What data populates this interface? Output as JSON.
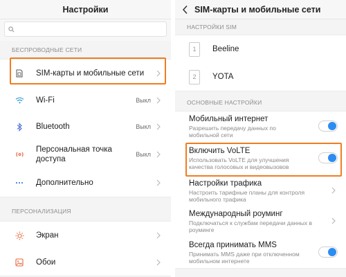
{
  "left": {
    "title": "Настройки",
    "search": {
      "placeholder": ""
    },
    "section_wireless": "БЕСПРОВОДНЫЕ СЕТИ",
    "wireless_items": [
      {
        "label": "SIM-карты и мобильные сети",
        "value": "",
        "icon": "sim-icon"
      },
      {
        "label": "Wi-Fi",
        "value": "Выкл",
        "icon": "wifi-icon"
      },
      {
        "label": "Bluetooth",
        "value": "Выкл",
        "icon": "bluetooth-icon"
      },
      {
        "label": "Персональная точка доступа",
        "value": "Выкл",
        "icon": "hotspot-icon"
      },
      {
        "label": "Дополнительно",
        "value": "",
        "icon": "more-icon"
      }
    ],
    "section_personal": "ПЕРСОНАЛИЗАЦИЯ",
    "personal_items": [
      {
        "label": "Экран",
        "icon": "brightness-icon"
      },
      {
        "label": "Обои",
        "icon": "wallpaper-icon"
      }
    ]
  },
  "right": {
    "title": "SIM-карты и мобильные сети",
    "section_sim": "НАСТРОЙКИ SIM",
    "sims": [
      {
        "slot": "1",
        "name": "Beeline"
      },
      {
        "slot": "2",
        "name": "YOTA"
      }
    ],
    "section_basic": "ОСНОВНЫЕ НАСТРОЙКИ",
    "items": [
      {
        "title": "Мобильный интернет",
        "subtitle": "Разрешить передачу данных по мобильной сети",
        "control": "toggle",
        "on": true
      },
      {
        "title": "Включить VoLTE",
        "subtitle": "Использовать VoLTE для улучшения качества голосовых и видеовызовов",
        "control": "toggle",
        "on": true
      },
      {
        "title": "Настройки трафика",
        "subtitle": "Настроить тарифные планы для контроля мобильного трафика",
        "control": "chevron"
      },
      {
        "title": "Международный роуминг",
        "subtitle": "Подключаться к службам передачи данных в роуминге",
        "control": "chevron"
      },
      {
        "title": "Всегда принимать MMS",
        "subtitle": "Принимать MMS даже при отключенном мобильном интернете",
        "control": "toggle",
        "on": true
      }
    ]
  },
  "colors": {
    "accent": "#2d8cf0",
    "highlight": "#f07d1f",
    "background": "#f4f4f4"
  }
}
